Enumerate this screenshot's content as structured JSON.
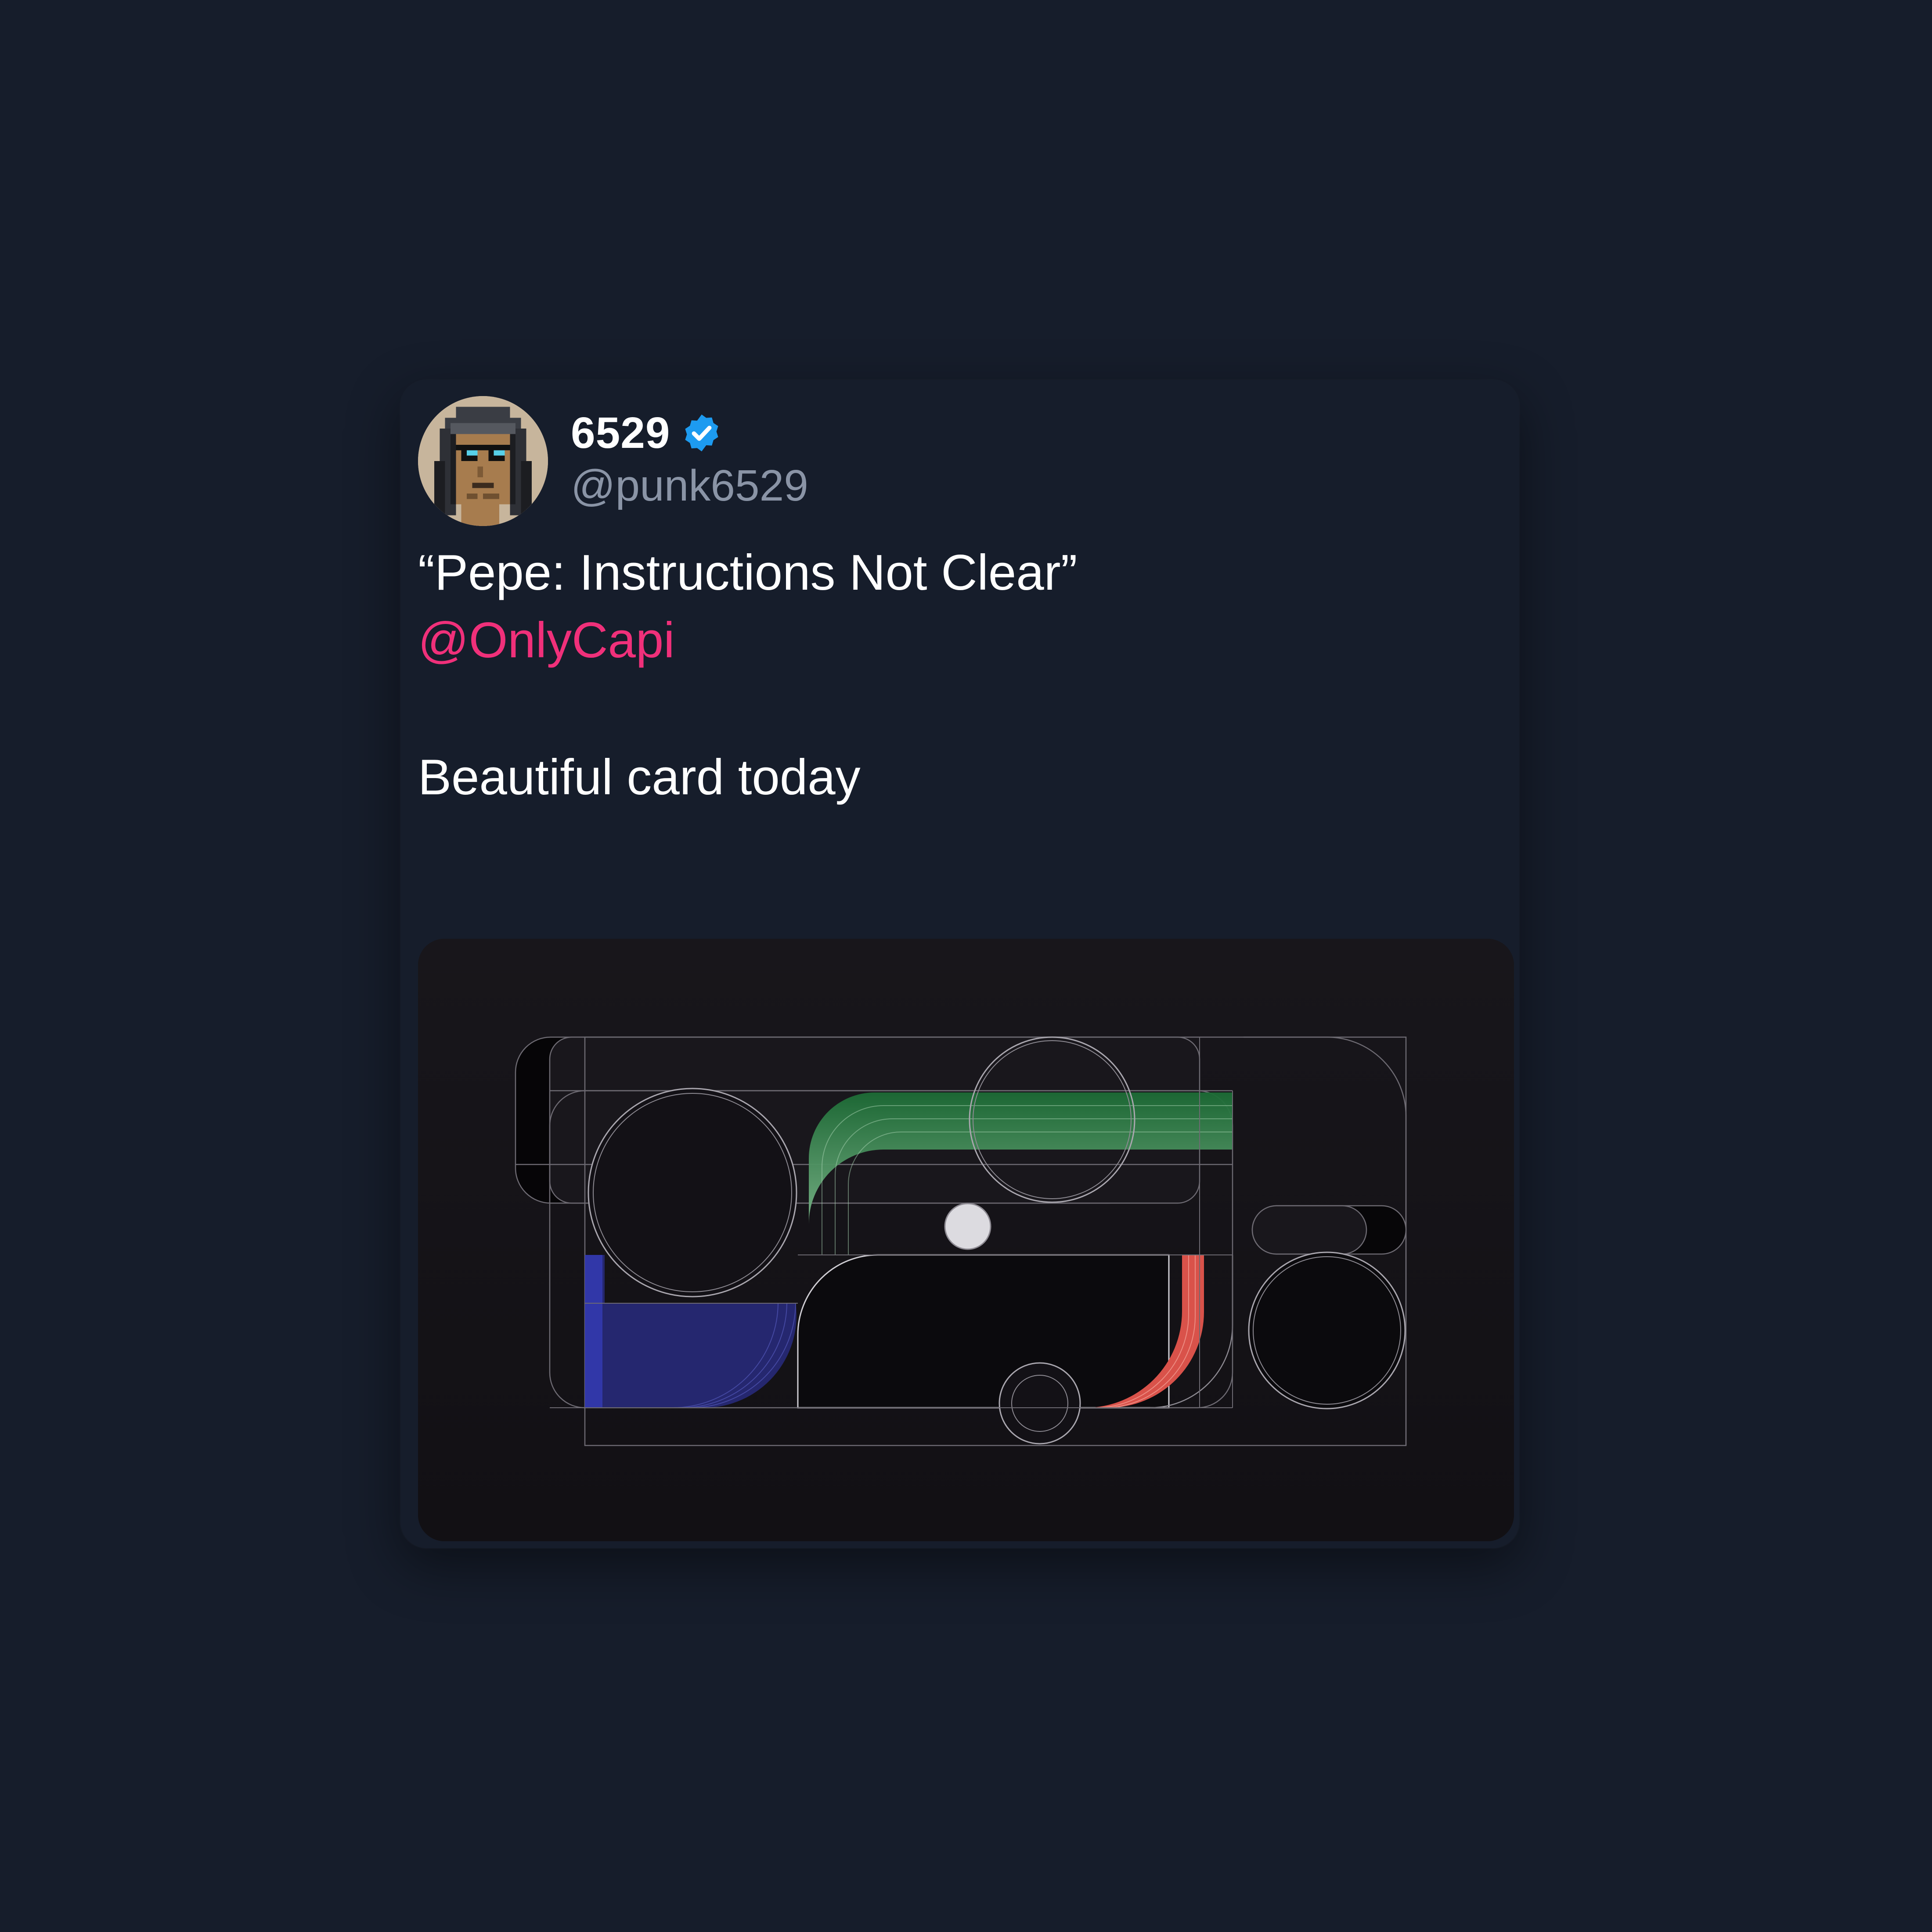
{
  "tweet": {
    "display_name": "6529",
    "handle": "@punk6529",
    "verified_icon": "verified-badge-icon",
    "avatar_icon": "pixel-punk-avatar",
    "text_line_1": "“Pepe: Instructions Not Clear”",
    "mention": "@OnlyCapi",
    "text_line_3": "Beautiful card today"
  },
  "colors": {
    "background": "#161d2b",
    "name": "#ffffff",
    "handle": "#8a94a6",
    "mention": "#f0307a",
    "verified": "#1d9bf0",
    "media_background": "#141216",
    "artwork_green": "#1f7a3a",
    "artwork_blue": "#2a2f9e",
    "artwork_red": "#e8604f"
  }
}
